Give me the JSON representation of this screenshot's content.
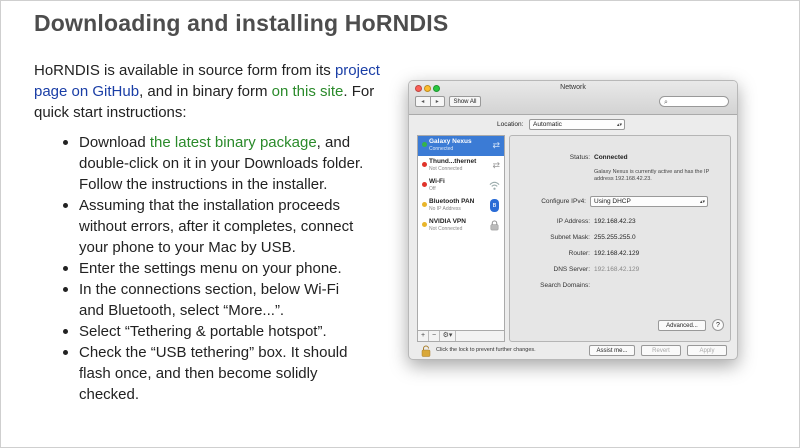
{
  "page": {
    "title": "Downloading and installing HoRNDIS",
    "intro": {
      "part1": "HoRNDIS is available in source form from its ",
      "link1": "project page on GitHub",
      "part2": ", and in binary form ",
      "link2": "on this site",
      "part3": ". For quick start instructions:"
    },
    "steps": [
      {
        "before": "Download ",
        "link": "the latest binary package",
        "after": ", and double-click on it in your Downloads folder. Follow the instructions in the installer."
      },
      {
        "text": "Assuming that the installation proceeds without errors, after it completes, connect your phone to your Mac by USB."
      },
      {
        "text": "Enter the settings menu on your phone."
      },
      {
        "text": "In the connections section, below Wi-Fi and Bluetooth, select “More...”."
      },
      {
        "text": "Select “Tethering & portable hotspot”."
      },
      {
        "text": "Check the “USB tethering” box. It should flash once, and then become solidly checked."
      }
    ]
  },
  "screenshot": {
    "window_title": "Network",
    "nav_back": "◂",
    "nav_forward": "▸",
    "show_all": "Show All",
    "search_icon": "⌕",
    "location_label": "Location:",
    "location_value": "Automatic",
    "services": [
      {
        "name": "Galaxy Nexus",
        "status": "Connected",
        "color": "#35b34a",
        "icon": "arrows-icon",
        "glyph": "⇄"
      },
      {
        "name": "Thund...thernet",
        "status": "Not Connected",
        "color": "#e0342b",
        "icon": "arrows-icon",
        "glyph": "⇄"
      },
      {
        "name": "Wi-Fi",
        "status": "Off",
        "color": "#e0342b",
        "icon": "wifi-icon",
        "glyph": "◠"
      },
      {
        "name": "Bluetooth PAN",
        "status": "No IP Address",
        "color": "#e9b62b",
        "icon": "bluetooth-icon",
        "glyph": "ʙ"
      },
      {
        "name": "NVIDIA VPN",
        "status": "Not Connected",
        "color": "#e9b62b",
        "icon": "lock-icon",
        "glyph": ""
      }
    ],
    "sidebar_tools": {
      "add": "+",
      "remove": "−",
      "gear": "⚙▾"
    },
    "detail": {
      "status_label": "Status:",
      "status_value": "Connected",
      "status_desc": "Galaxy Nexus is currently active and has the IP address 192.168.42.23.",
      "configure_label": "Configure IPv4:",
      "configure_value": "Using DHCP",
      "ip_label": "IP Address:",
      "ip_value": "192.168.42.23",
      "subnet_label": "Subnet Mask:",
      "subnet_value": "255.255.255.0",
      "router_label": "Router:",
      "router_value": "192.168.42.129",
      "dns_label": "DNS Server:",
      "dns_value": "192.168.42.129",
      "search_domains_label": "Search Domains:",
      "advanced": "Advanced...",
      "help": "?"
    },
    "footer": {
      "lock_text": "Click the lock to prevent further changes.",
      "assist": "Assist me...",
      "revert": "Revert",
      "apply": "Apply"
    },
    "select_arrows": "▴▾",
    "selected_color": "#3b7bd5"
  }
}
